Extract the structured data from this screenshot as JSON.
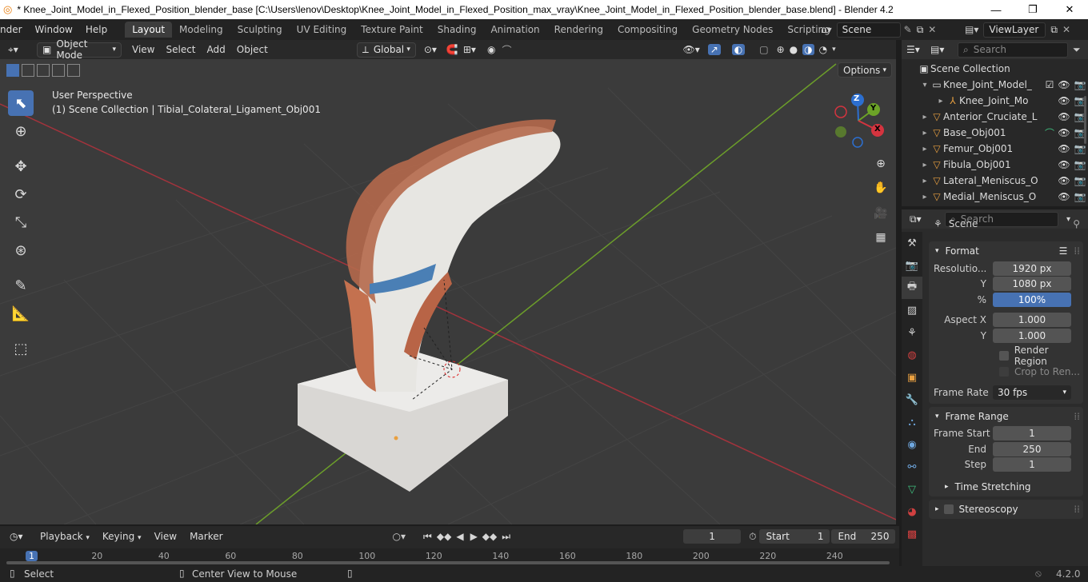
{
  "window": {
    "title": "* Knee_Joint_Model_in_Flexed_Position_blender_base [C:\\Users\\lenov\\Desktop\\Knee_Joint_Model_in_Flexed_Position_max_vray\\Knee_Joint_Model_in_Flexed_Position_blender_base.blend] - Blender 4.2",
    "minimize": "—",
    "restore": "❐",
    "close": "✕"
  },
  "menu": [
    "nder",
    "Window",
    "Help"
  ],
  "workspaces": [
    "Layout",
    "Modeling",
    "Sculpting",
    "UV Editing",
    "Texture Paint",
    "Shading",
    "Animation",
    "Rendering",
    "Compositing",
    "Geometry Nodes",
    "Scripting"
  ],
  "add_workspace": "+",
  "scene_field": "Scene",
  "viewlayer_field": "ViewLayer",
  "viewport": {
    "mode": "Object Mode",
    "menus": [
      "View",
      "Select",
      "Add",
      "Object"
    ],
    "orientation": "Global",
    "options": "Options",
    "info_line1": "User Perspective",
    "info_line2": "(1) Scene Collection | Tibial_Colateral_Ligament_Obj001",
    "gizmo": {
      "z": "Z",
      "y": "Y",
      "x": "X"
    }
  },
  "outliner": {
    "search_placeholder": "Search",
    "root": "Scene Collection",
    "rows": [
      {
        "label": "Knee_Joint_Model_",
        "indent": 1,
        "expanded": true
      },
      {
        "label": "Knee_Joint_Mo",
        "indent": 2,
        "expanded": false
      },
      {
        "label": "Anterior_Cruciate_L",
        "indent": 1,
        "expanded": false
      },
      {
        "label": "Base_Obj001",
        "indent": 1,
        "expanded": false
      },
      {
        "label": "Femur_Obj001",
        "indent": 1,
        "expanded": false
      },
      {
        "label": "Fibula_Obj001",
        "indent": 1,
        "expanded": false
      },
      {
        "label": "Lateral_Meniscus_O",
        "indent": 1,
        "expanded": false
      },
      {
        "label": "Medial_Meniscus_O",
        "indent": 1,
        "expanded": false
      }
    ]
  },
  "properties": {
    "search_placeholder": "Search",
    "context": "Scene",
    "format": {
      "title": "Format",
      "resolution_x_label": "Resolutio...",
      "resolution_x": "1920 px",
      "resolution_y_label": "Y",
      "resolution_y": "1080 px",
      "percent_label": "%",
      "percent": "100%",
      "aspect_x_label": "Aspect X",
      "aspect_x": "1.000",
      "aspect_y_label": "Y",
      "aspect_y": "1.000",
      "render_region": "Render Region",
      "crop": "Crop to Ren...",
      "frame_rate_label": "Frame Rate",
      "frame_rate": "30 fps"
    },
    "frame_range": {
      "title": "Frame Range",
      "start_label": "Frame Start",
      "start": "1",
      "end_label": "End",
      "end": "250",
      "step_label": "Step",
      "step": "1"
    },
    "time_stretching": "Time Stretching",
    "stereoscopy": "Stereoscopy"
  },
  "timeline": {
    "menus": [
      "Playback",
      "Keying",
      "View",
      "Marker"
    ],
    "current_frame": "1",
    "start_label": "Start",
    "start": "1",
    "end_label": "End",
    "end": "250",
    "ruler": [
      "1",
      "20",
      "40",
      "60",
      "80",
      "100",
      "120",
      "140",
      "160",
      "180",
      "200",
      "220",
      "240"
    ]
  },
  "status": {
    "select": "Select",
    "center": "Center View to Mouse",
    "version": "4.2.0"
  },
  "colors": {
    "accent": "#4772b3",
    "object_orange": "#e9a040"
  }
}
